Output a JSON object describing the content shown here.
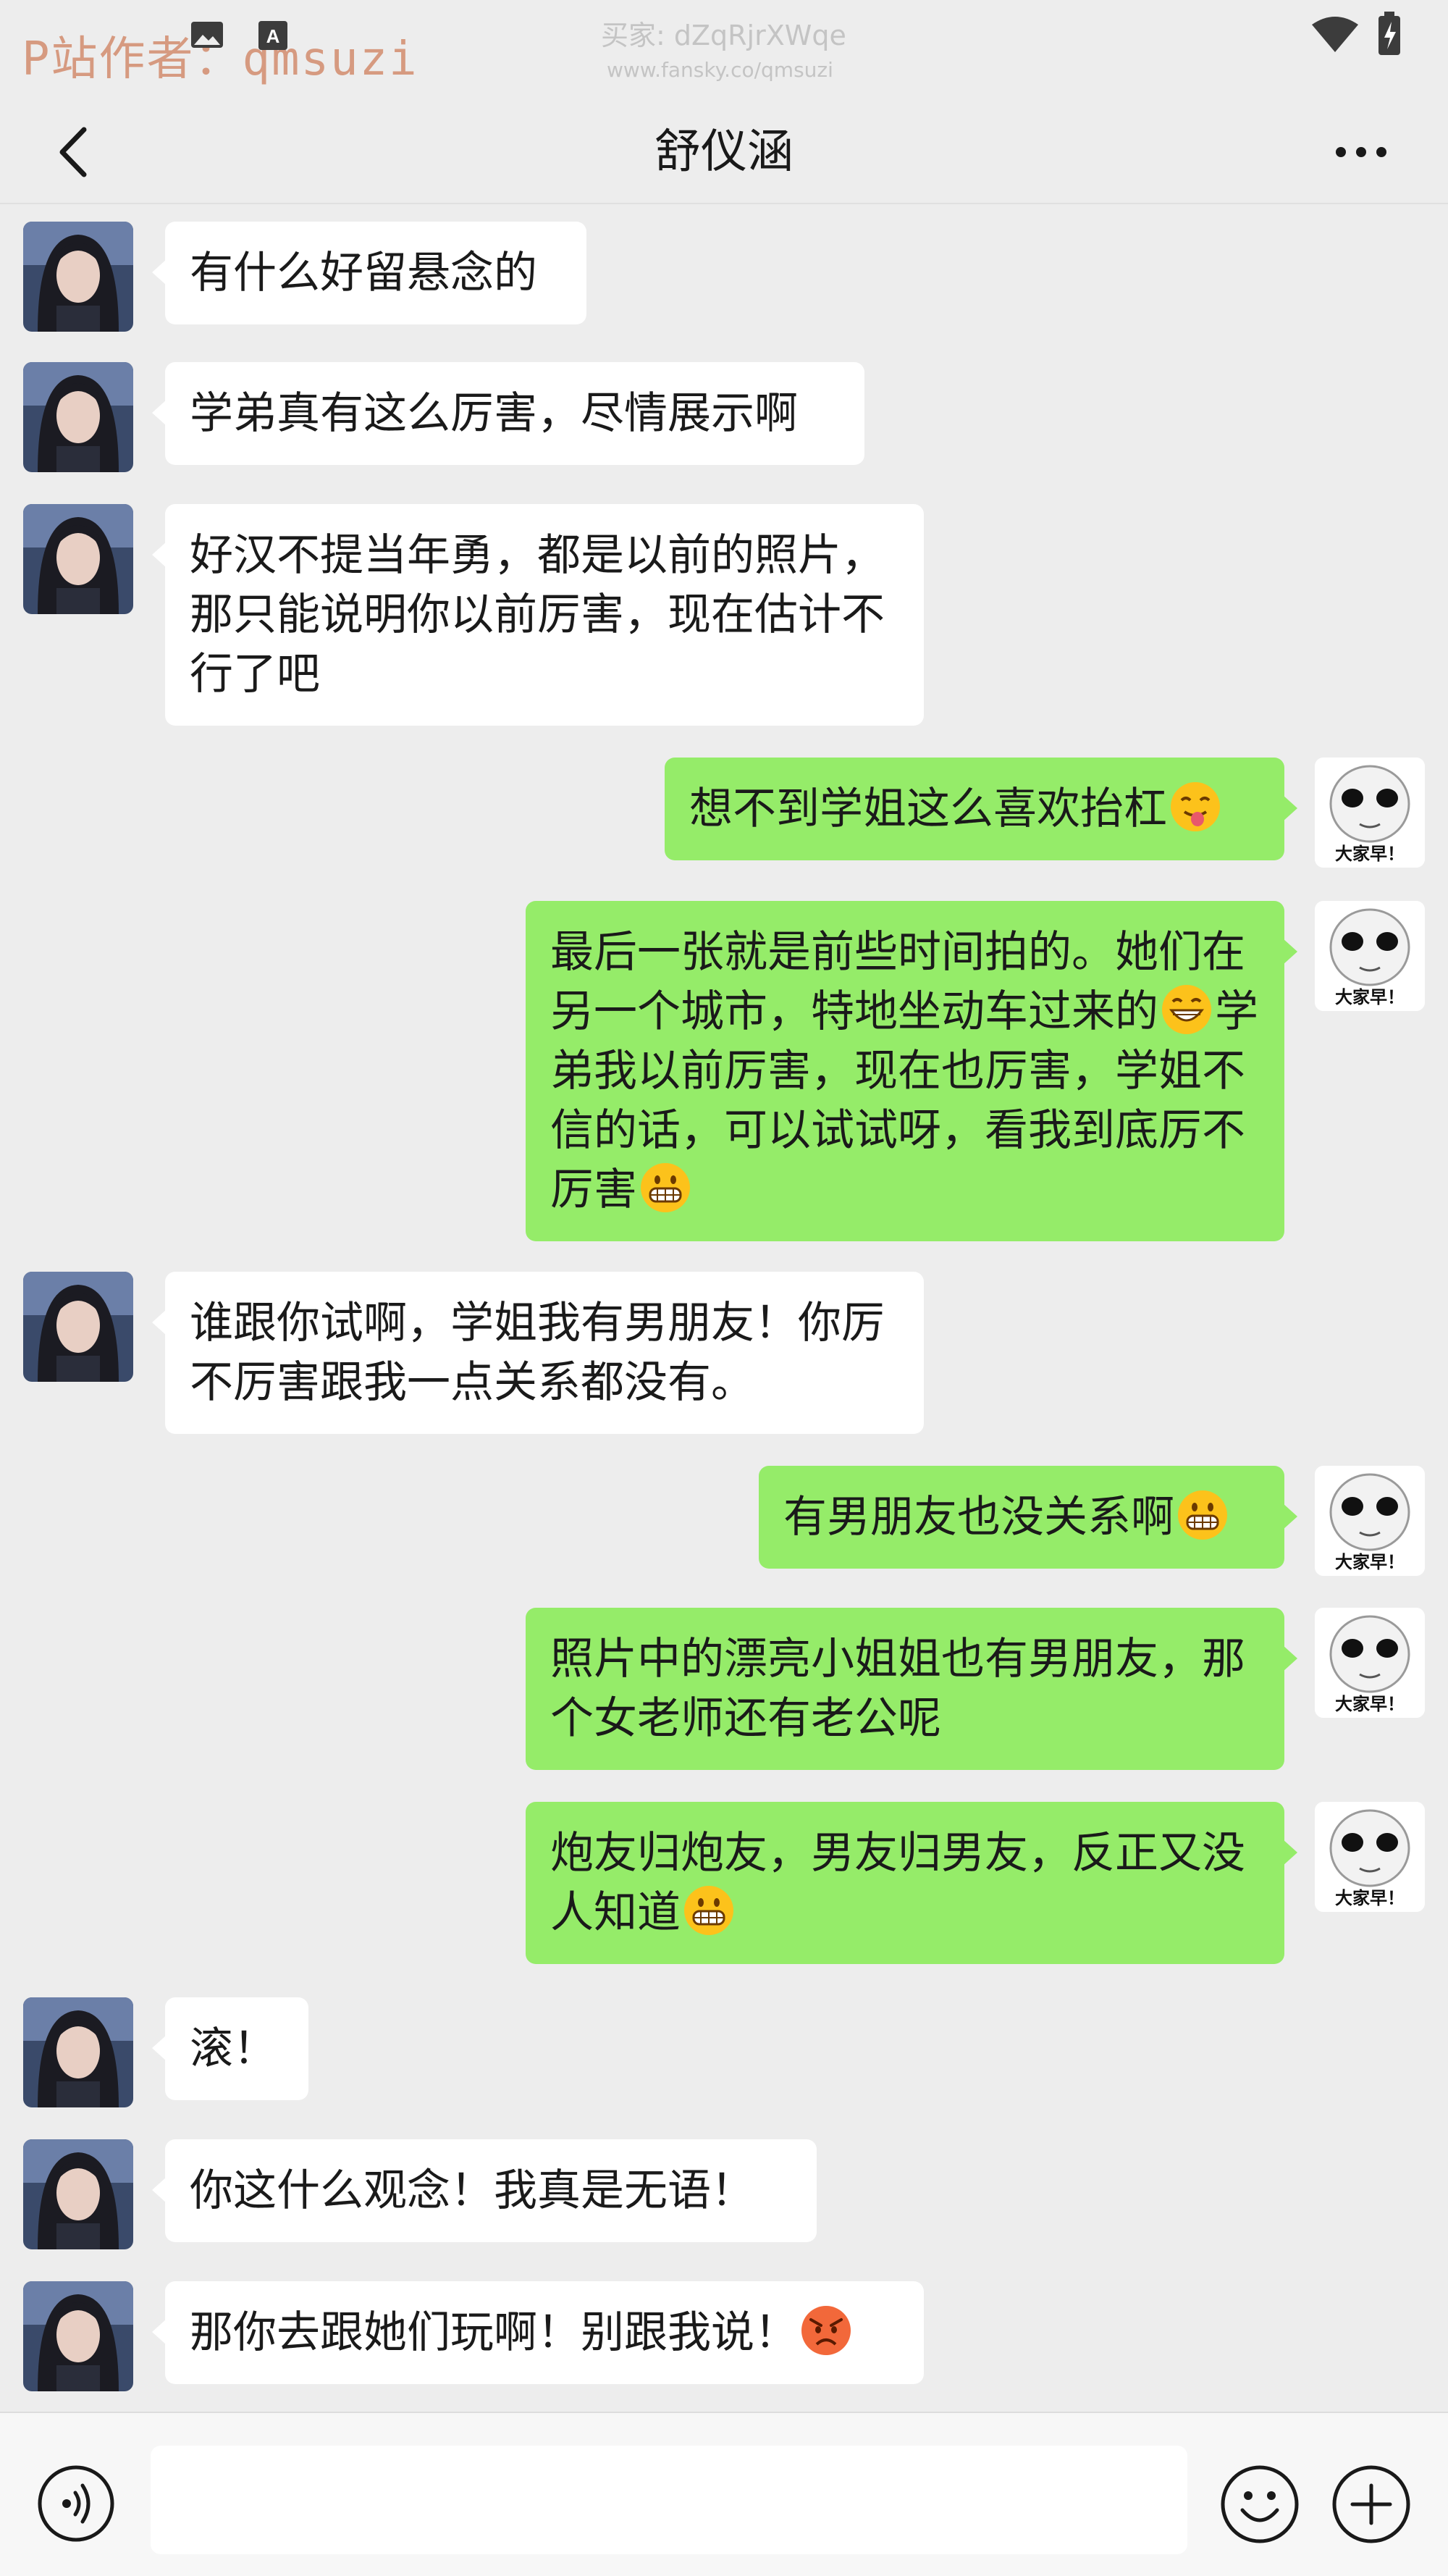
{
  "watermark": {
    "author": "P站作者：qmsuzi",
    "buyer": "买家: dZqRjrXWqe",
    "url": "www.fansky.co/qmsuzi"
  },
  "header": {
    "title": "舒仪涵",
    "back_icon": "chevron-left-icon",
    "more_icon": "more-dots-icon"
  },
  "messages": [
    {
      "from": "her",
      "segments": [
        {
          "t": "有什么好留悬念的"
        }
      ]
    },
    {
      "from": "her",
      "segments": [
        {
          "t": "学弟真有这么厉害，尽情展示啊"
        }
      ]
    },
    {
      "from": "her",
      "segments": [
        {
          "t": "好汉不提当年勇，都是以前的照片，那只能说明你以前厉害，现在估计不行了吧"
        }
      ]
    },
    {
      "from": "me",
      "segments": [
        {
          "t": "想不到学姐这么喜欢抬杠"
        },
        {
          "emoji": "tongue-out-emoji"
        }
      ]
    },
    {
      "from": "me",
      "segments": [
        {
          "t": "最后一张就是前些时间拍的。她们在另一个城市，特地坐动车过来的"
        },
        {
          "emoji": "grin-emoji"
        },
        {
          "t": "学弟我以前厉害，现在也厉害，学姐不信的话，可以试试呀，看我到底厉不厉害"
        },
        {
          "emoji": "grimace-emoji"
        }
      ]
    },
    {
      "from": "her",
      "segments": [
        {
          "t": "谁跟你试啊，学姐我有男朋友！你厉不厉害跟我一点关系都没有。"
        }
      ]
    },
    {
      "from": "me",
      "segments": [
        {
          "t": "有男朋友也没关系啊"
        },
        {
          "emoji": "grimace-emoji"
        }
      ]
    },
    {
      "from": "me",
      "segments": [
        {
          "t": "照片中的漂亮小姐姐也有男朋友，那个女老师还有老公呢"
        }
      ]
    },
    {
      "from": "me",
      "segments": [
        {
          "t": "炮友归炮友，男友归男友，反正又没人知道"
        },
        {
          "emoji": "grimace-emoji"
        }
      ]
    },
    {
      "from": "her",
      "segments": [
        {
          "t": "滚！"
        }
      ]
    },
    {
      "from": "her",
      "segments": [
        {
          "t": "你这什么观念！我真是无语！"
        }
      ]
    },
    {
      "from": "her",
      "segments": [
        {
          "t": "那你去跟她们玩啊！别跟我说！"
        },
        {
          "emoji": "angry-emoji"
        }
      ]
    }
  ],
  "avatars": {
    "her_icon": "contact-avatar-girl",
    "me_icon": "meme-face-avatar",
    "me_caption": "大家早！"
  },
  "composer": {
    "voice_icon": "voice-icon",
    "input_value": "",
    "emoji_icon": "smiley-icon",
    "plus_icon": "plus-icon"
  },
  "colors": {
    "background": "#ededed",
    "incoming_bubble": "#ffffff",
    "outgoing_bubble": "#95ec69",
    "text": "#1a1a1a",
    "watermark_author": "#d69a80"
  }
}
